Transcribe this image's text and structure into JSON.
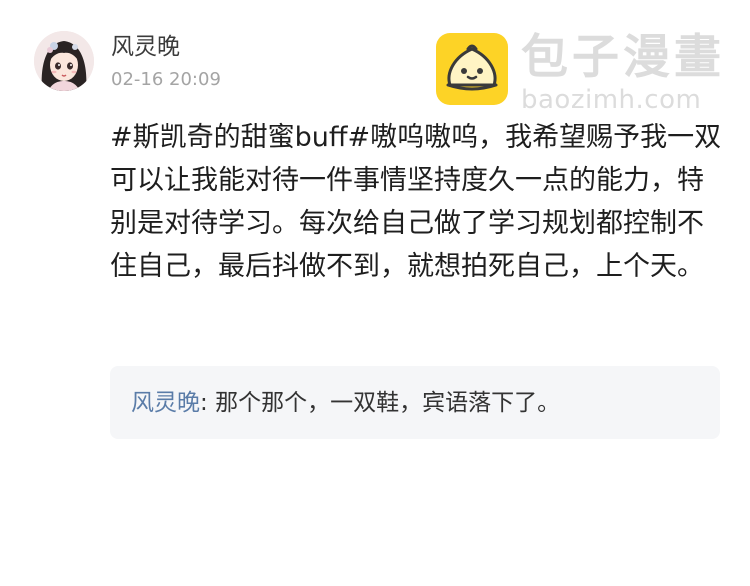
{
  "post": {
    "username": "风灵晚",
    "timestamp": "02-16 20:09",
    "content": "#斯凯奇的甜蜜buff#嗷呜嗷呜，我希望赐予我一双可以让我能对待一件事情坚持度久一点的能力，特别是对待学习。每次给自己做了学习规划都控制不住自己，最后抖做不到，就想拍死自己，上个天。"
  },
  "comment": {
    "author": "风灵晚",
    "separator": ": ",
    "text": "那个那个，一双鞋，宾语落下了。"
  },
  "watermark": {
    "title": "包子漫畫",
    "domain": "baozimh.com",
    "logo_icon": "bun-mascot-icon",
    "logo_color": "#fdd326"
  },
  "colors": {
    "username": "#3b3b3b",
    "timestamp": "#a4a4a4",
    "comment_author": "#5a7ca8",
    "comment_background": "#f5f6f8"
  }
}
